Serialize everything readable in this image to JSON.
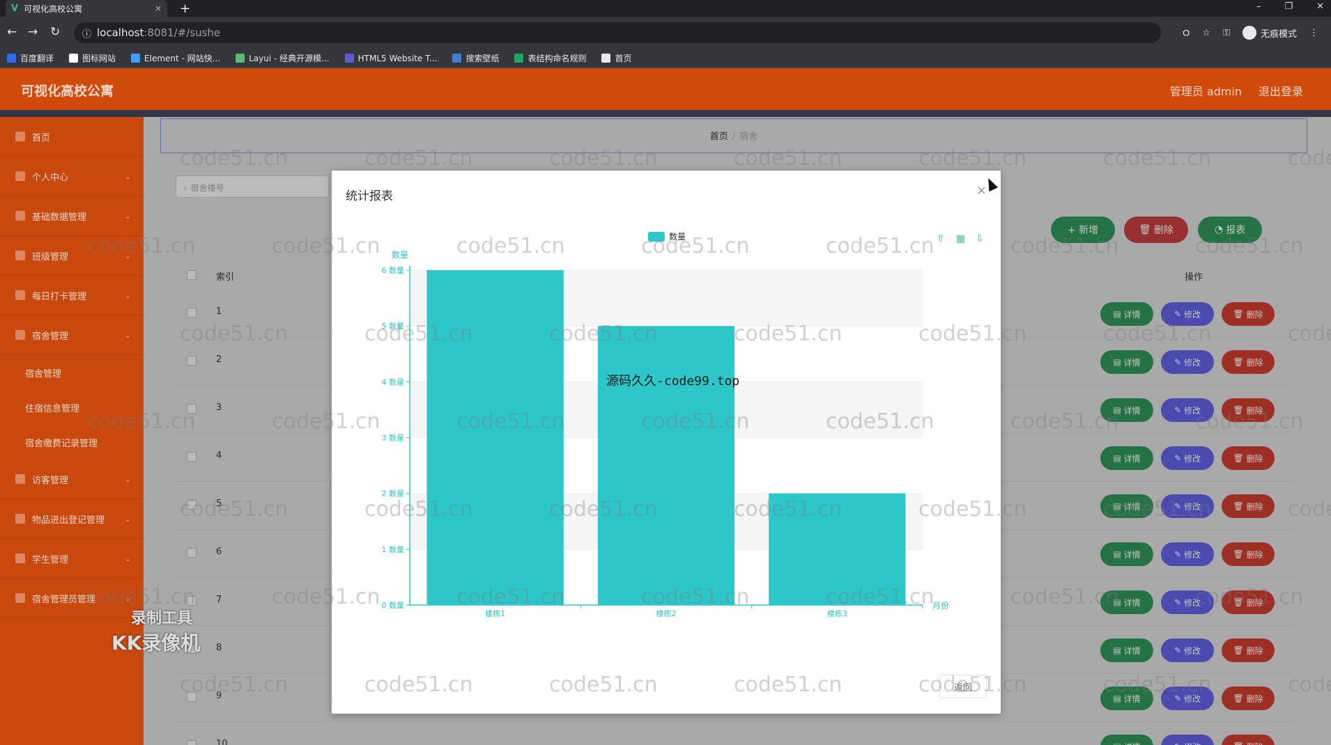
{
  "browser": {
    "tab_title": "可视化高校公寓",
    "tab_close": "×",
    "new_tab": "+",
    "url_host": "localhost",
    "url_path": ":8081/#/sushe",
    "incognito_label": "无痕模式",
    "window_controls": [
      "–",
      "❐",
      "✕"
    ],
    "bookmarks": [
      {
        "label": "百度翻译",
        "color": "#2d6ee6"
      },
      {
        "label": "图标网站",
        "color": "#ffffff"
      },
      {
        "label": "Element - 网站快...",
        "color": "#409eff"
      },
      {
        "label": "Layui - 经典开源模...",
        "color": "#5fb878"
      },
      {
        "label": "HTML5 Website T...",
        "color": "#5b5bd6"
      },
      {
        "label": "搜索壁纸",
        "color": "#3e7ed8"
      },
      {
        "label": "表结构命名规则",
        "color": "#21a366"
      },
      {
        "label": "首页",
        "color": "#e8eaed"
      }
    ]
  },
  "app": {
    "title": "可视化高校公寓",
    "admin_label": "管理员 admin",
    "logout_label": "退出登录"
  },
  "sidebar": {
    "items": [
      {
        "label": "首页",
        "has_arrow": false
      },
      {
        "label": "个人中心",
        "has_arrow": true
      },
      {
        "label": "基础数据管理",
        "has_arrow": true
      },
      {
        "label": "班级管理",
        "has_arrow": true
      },
      {
        "label": "每日打卡管理",
        "has_arrow": true
      },
      {
        "label": "宿舍管理",
        "has_arrow": true
      }
    ],
    "sub_items": [
      "宿舍管理",
      "住宿信息管理",
      "宿舍缴费记录管理"
    ],
    "items_after": [
      {
        "label": "访客管理",
        "has_arrow": true
      },
      {
        "label": "物品进出登记管理",
        "has_arrow": true
      },
      {
        "label": "学生管理",
        "has_arrow": true
      },
      {
        "label": "宿舍管理员管理",
        "has_arrow": true
      }
    ]
  },
  "breadcrumb": {
    "home": "首页",
    "sep": "/",
    "current": "宿舍"
  },
  "search": {
    "placeholder": "宿舍楼号"
  },
  "toolbar": {
    "add": "+ 新增",
    "delete": "删除",
    "report": "报表"
  },
  "table": {
    "headers": {
      "index": "索引",
      "actions": "操作"
    },
    "rows": [
      "1",
      "2",
      "3",
      "4",
      "5",
      "6",
      "7",
      "8",
      "9",
      "10"
    ],
    "row_actions": {
      "detail": "详情",
      "edit": "修改",
      "delete": "删除"
    }
  },
  "modal": {
    "title": "统计报表",
    "close": "×",
    "return_label": "返回"
  },
  "chart_data": {
    "type": "bar",
    "categories": [
      "楼栋1",
      "楼栋2",
      "楼栋3"
    ],
    "series": [
      {
        "name": "数量",
        "values": [
          6,
          5,
          2
        ]
      }
    ],
    "ylabel": "数量",
    "xlabel": "月份",
    "ylim": [
      0,
      6
    ],
    "yticks": [
      "0 数量",
      "1 数量",
      "2 数量",
      "3 数量",
      "4 数量",
      "5 数量",
      "6 数量"
    ],
    "color": "#2ec7c9",
    "legend": "top-center",
    "grid": true
  },
  "watermarks": {
    "repeat": "code51.cn",
    "center": "源码久久-code99.top",
    "rec1": "录制工具",
    "rec2": "KK录像机"
  },
  "colors": {
    "header": "#d04a0c",
    "sidebar": "#c9480e",
    "green": "#2e8b57",
    "red": "#c0392b",
    "purple": "#6a5acd"
  }
}
